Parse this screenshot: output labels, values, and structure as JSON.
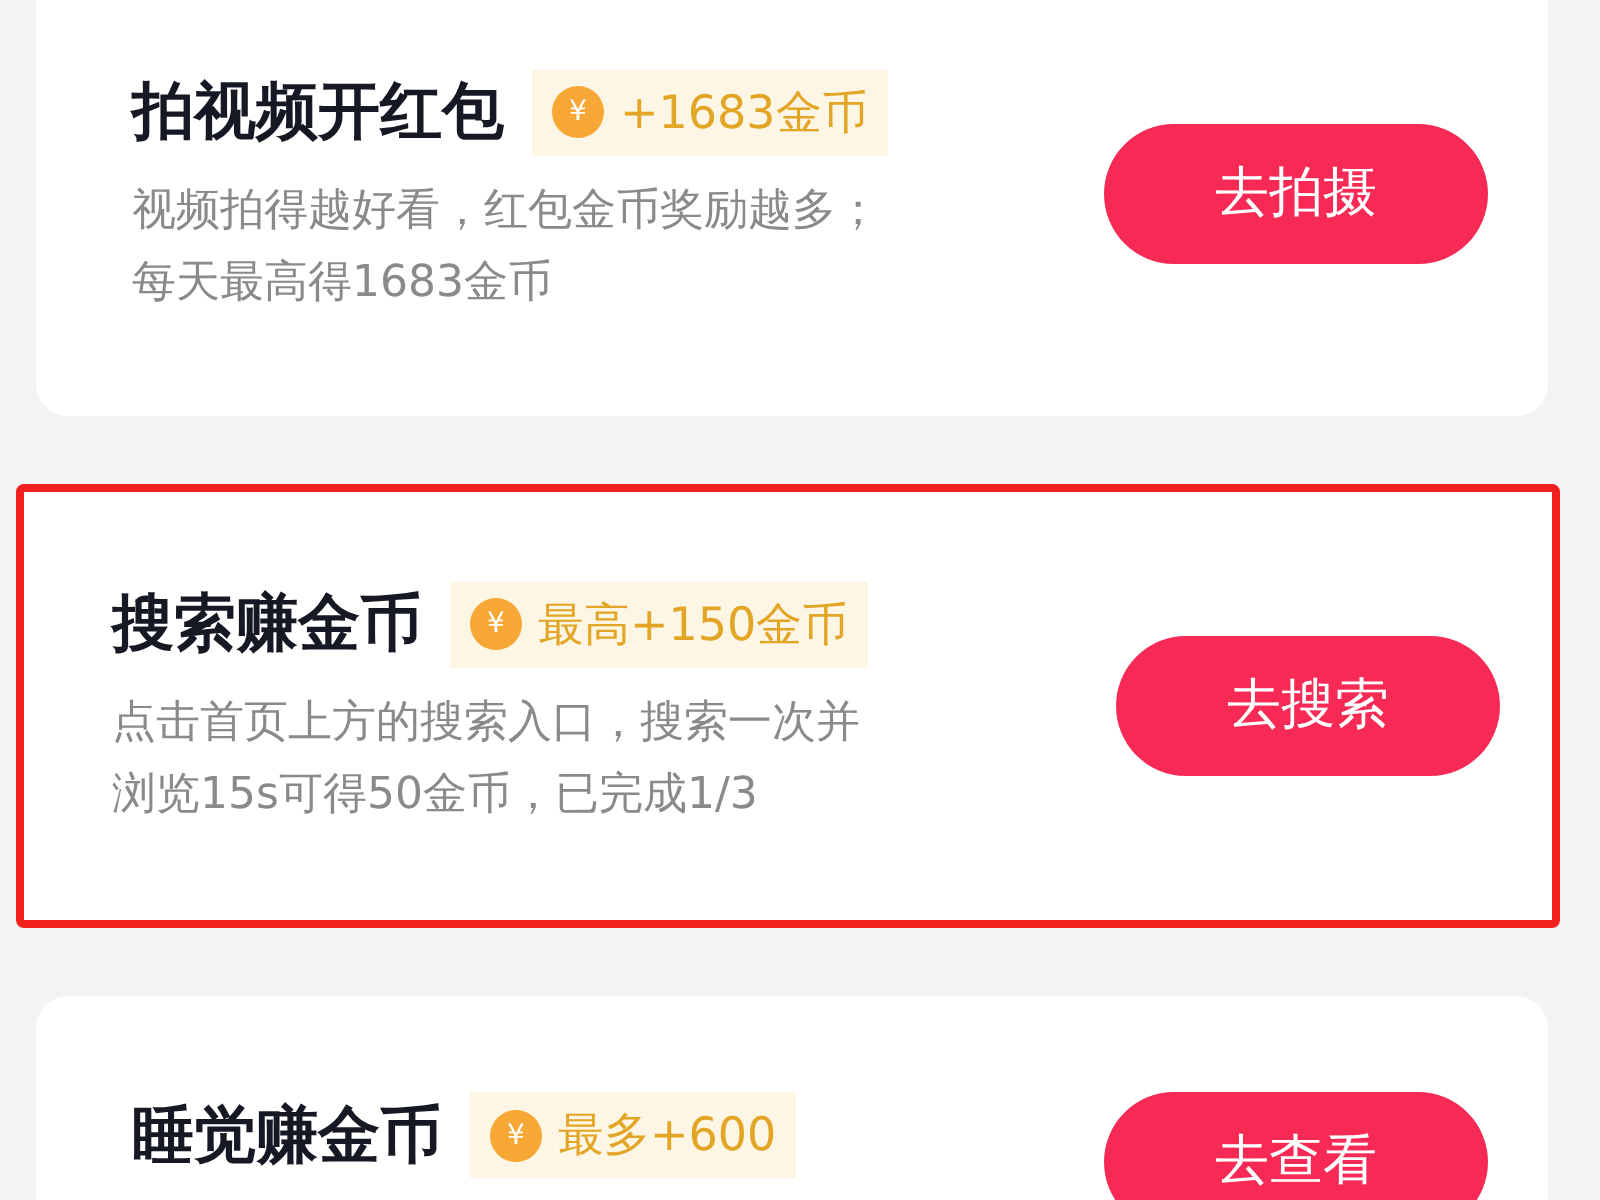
{
  "tasks": [
    {
      "title": "拍视频开红包",
      "coin_symbol": "¥",
      "reward": "+1683金币",
      "description": "视频拍得越好看，红包金币奖励越多；每天最高得1683金币",
      "button": "去拍摄",
      "highlighted": false
    },
    {
      "title": "搜索赚金币",
      "coin_symbol": "¥",
      "reward": "最高+150金币",
      "description": "点击首页上方的搜索入口，搜索一次并浏览15s可得50金币，已完成1/3",
      "button": "去搜索",
      "highlighted": true
    },
    {
      "title": "睡觉赚金币",
      "coin_symbol": "¥",
      "reward": "最多+600",
      "button": "去查看",
      "highlighted": false
    }
  ]
}
